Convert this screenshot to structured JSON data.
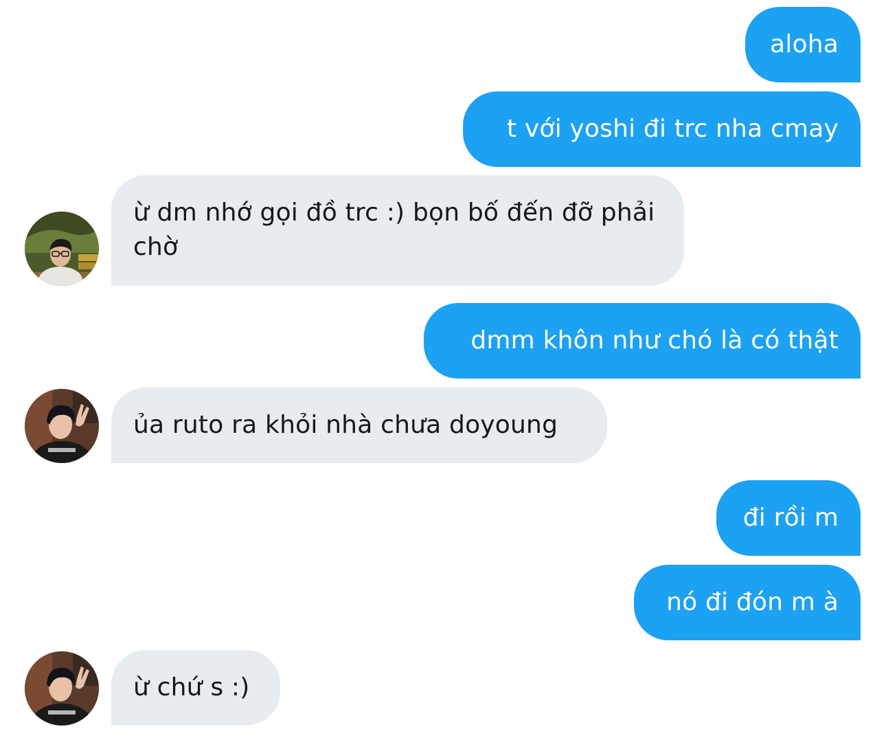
{
  "conversation": {
    "messages": [
      {
        "direction": "outgoing",
        "text": "aloha"
      },
      {
        "direction": "outgoing",
        "text": "t với yoshi đi trc nha cmay"
      },
      {
        "direction": "incoming",
        "text": "ừ dm nhớ gọi đồ trc :) bọn bố đến đỡ phải chờ",
        "avatar": "avatar-photo-glasses"
      },
      {
        "direction": "outgoing",
        "text": "dmm khôn như chó là có thật"
      },
      {
        "direction": "incoming",
        "text": "ủa ruto ra khỏi nhà chưa doyoung",
        "avatar": "avatar-photo-peace-sign"
      },
      {
        "direction": "outgoing",
        "text": "đi rồi m"
      },
      {
        "direction": "outgoing",
        "text": "nó đi đón m à"
      },
      {
        "direction": "incoming",
        "text": "ừ chứ s :)",
        "avatar": "avatar-photo-peace-sign"
      }
    ]
  },
  "colors": {
    "outgoing_bubble": "#1da1f2",
    "incoming_bubble": "#e6ecf0",
    "incoming_text": "#14171a",
    "background": "#ffffff"
  }
}
